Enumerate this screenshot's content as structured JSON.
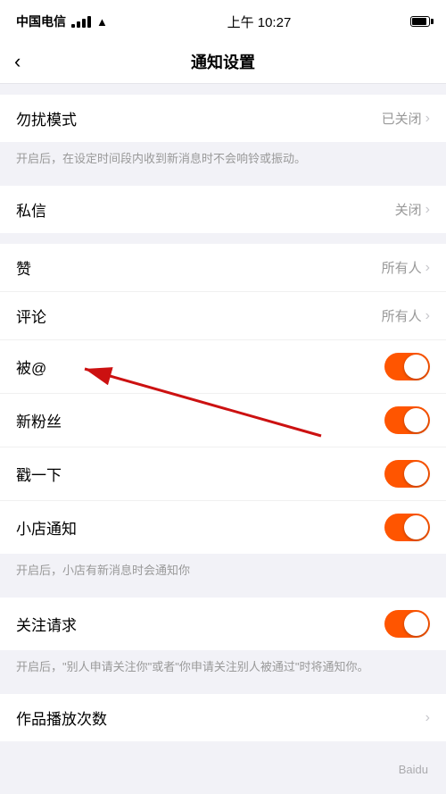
{
  "statusBar": {
    "carrier": "中国电信",
    "time": "上午 10:27",
    "battery": "full"
  },
  "navBar": {
    "backIcon": "‹",
    "title": "通知设置"
  },
  "sections": [
    {
      "id": "doNotDisturb",
      "rows": [
        {
          "label": "勿扰模式",
          "value": "已关闭",
          "type": "chevron"
        }
      ],
      "description": "开启后，在设定时间段内收到新消息时不会响铃或振动。"
    },
    {
      "id": "directMessage",
      "rows": [
        {
          "label": "私信",
          "value": "关闭",
          "type": "chevron"
        }
      ]
    },
    {
      "id": "interactions",
      "rows": [
        {
          "label": "赞",
          "value": "所有人",
          "type": "chevron"
        },
        {
          "label": "评论",
          "value": "所有人",
          "type": "chevron"
        },
        {
          "label": "被@",
          "value": "",
          "type": "toggle",
          "toggleOn": true
        },
        {
          "label": "新粉丝",
          "value": "",
          "type": "toggle",
          "toggleOn": true
        },
        {
          "label": "戳一下",
          "value": "",
          "type": "toggle",
          "toggleOn": true
        },
        {
          "label": "小店通知",
          "value": "",
          "type": "toggle",
          "toggleOn": true
        }
      ],
      "description": "开启后，小店有新消息时会通知你"
    },
    {
      "id": "follow",
      "rows": [
        {
          "label": "关注请求",
          "value": "",
          "type": "toggle",
          "toggleOn": true
        }
      ],
      "description": "开启后，\"别人申请关注你\"或者\"你申请关注别人被通过\"时将通知你。"
    },
    {
      "id": "playCount",
      "rows": [
        {
          "label": "作品播放次数",
          "value": "",
          "type": "chevron"
        }
      ]
    }
  ],
  "watermark": "Baidu"
}
